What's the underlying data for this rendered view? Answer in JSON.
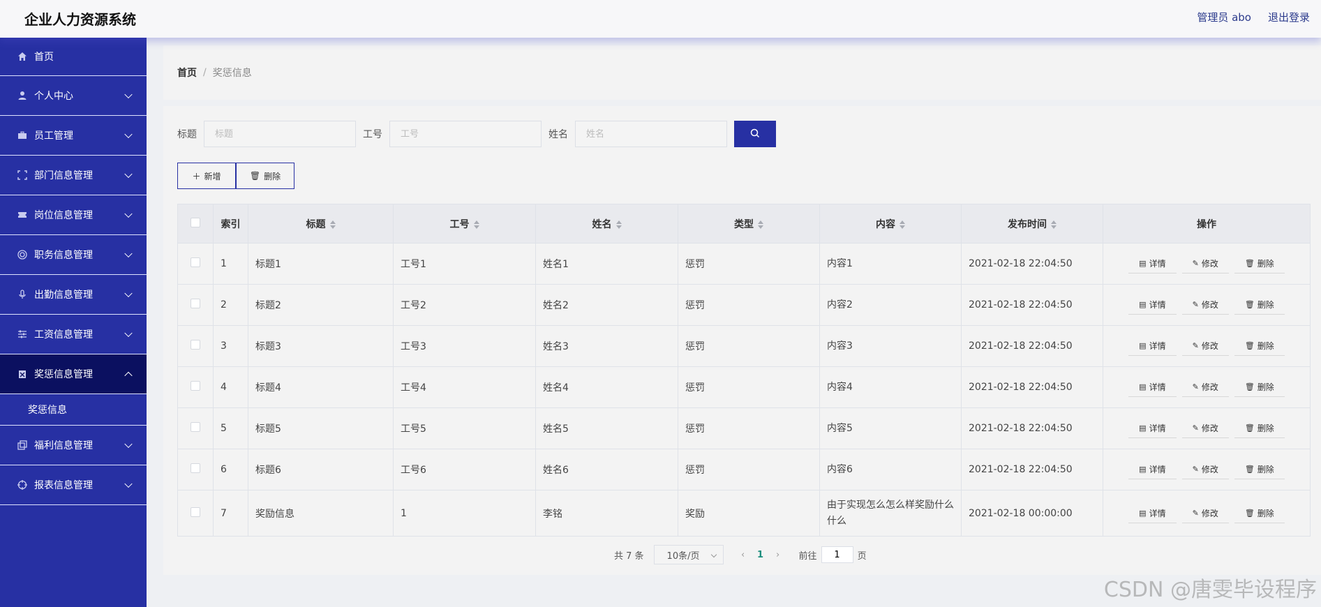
{
  "header": {
    "title": "企业人力资源系统",
    "user": "管理员 abo",
    "logout": "退出登录"
  },
  "sidebar": {
    "items": [
      {
        "label": "首页",
        "icon": "home-icon"
      },
      {
        "label": "个人中心",
        "icon": "user-icon"
      },
      {
        "label": "员工管理",
        "icon": "briefcase-icon"
      },
      {
        "label": "部门信息管理",
        "icon": "frame-icon"
      },
      {
        "label": "岗位信息管理",
        "icon": "ticket-icon"
      },
      {
        "label": "职务信息管理",
        "icon": "target-icon"
      },
      {
        "label": "出勤信息管理",
        "icon": "microphone-icon"
      },
      {
        "label": "工资信息管理",
        "icon": "sliders-icon"
      },
      {
        "label": "奖惩信息管理",
        "icon": "clipboard-icon"
      },
      {
        "label": "福利信息管理",
        "icon": "copy-icon"
      },
      {
        "label": "报表信息管理",
        "icon": "crosshair-icon"
      }
    ],
    "submenu_label": "奖惩信息"
  },
  "breadcrumb": {
    "home": "首页",
    "separator": "/",
    "current": "奖惩信息"
  },
  "search": {
    "title_label": "标题",
    "title_placeholder": "标题",
    "number_label": "工号",
    "number_placeholder": "工号",
    "name_label": "姓名",
    "name_placeholder": "姓名"
  },
  "actions": {
    "add": "新增",
    "delete": "删除"
  },
  "table": {
    "headers": [
      "索引",
      "标题",
      "工号",
      "姓名",
      "类型",
      "内容",
      "发布时间",
      "操作"
    ],
    "rows": [
      {
        "index": "1",
        "title": "标题1",
        "number": "工号1",
        "name": "姓名1",
        "type": "惩罚",
        "content": "内容1",
        "time": "2021-02-18 22:04:50"
      },
      {
        "index": "2",
        "title": "标题2",
        "number": "工号2",
        "name": "姓名2",
        "type": "惩罚",
        "content": "内容2",
        "time": "2021-02-18 22:04:50"
      },
      {
        "index": "3",
        "title": "标题3",
        "number": "工号3",
        "name": "姓名3",
        "type": "惩罚",
        "content": "内容3",
        "time": "2021-02-18 22:04:50"
      },
      {
        "index": "4",
        "title": "标题4",
        "number": "工号4",
        "name": "姓名4",
        "type": "惩罚",
        "content": "内容4",
        "time": "2021-02-18 22:04:50"
      },
      {
        "index": "5",
        "title": "标题5",
        "number": "工号5",
        "name": "姓名5",
        "type": "惩罚",
        "content": "内容5",
        "time": "2021-02-18 22:04:50"
      },
      {
        "index": "6",
        "title": "标题6",
        "number": "工号6",
        "name": "姓名6",
        "type": "惩罚",
        "content": "内容6",
        "time": "2021-02-18 22:04:50"
      },
      {
        "index": "7",
        "title": "奖励信息",
        "number": "1",
        "name": "李铭",
        "type": "奖励",
        "content": "由于实现怎么怎么样奖励什么什么",
        "time": "2021-02-18 00:00:00"
      }
    ],
    "ops": {
      "detail": "详情",
      "edit": "修改",
      "delete": "删除"
    }
  },
  "pagination": {
    "total": "共 7 条",
    "page_size": "10条/页",
    "current_page": "1",
    "goto_label": "前往",
    "goto_value": "1",
    "page_suffix": "页"
  },
  "watermark": "CSDN @唐雯毕设程序",
  "colors": {
    "sidebar": "#2730a3",
    "sidebar_active": "#0b1060",
    "accent": "#2730a3",
    "page_link": "#1c8e7d"
  }
}
